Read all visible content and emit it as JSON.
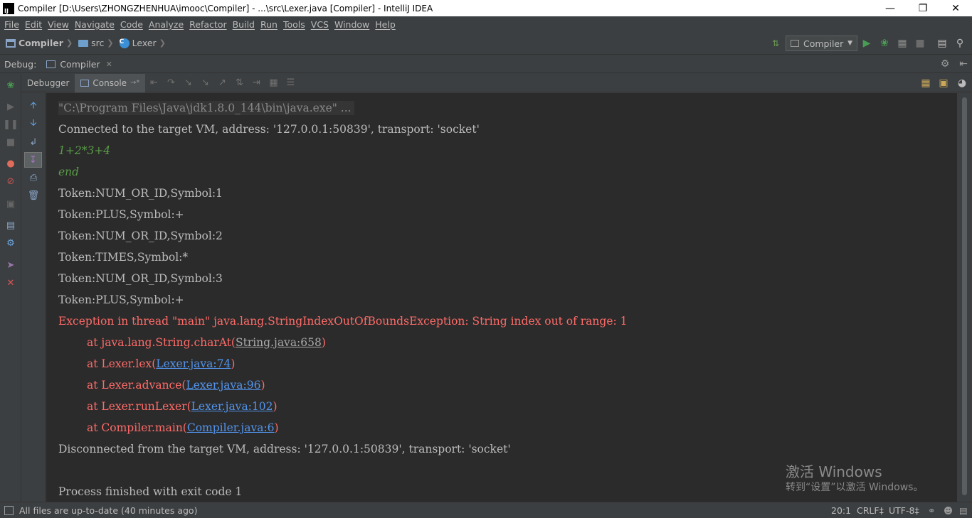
{
  "window": {
    "title": "Compiler [D:\\Users\\ZHONGZHENHUA\\imooc\\Compiler] - ...\\src\\Lexer.java [Compiler] - IntelliJ IDEA",
    "app_icon_text": "IJ"
  },
  "menu": [
    "File",
    "Edit",
    "View",
    "Navigate",
    "Code",
    "Analyze",
    "Refactor",
    "Build",
    "Run",
    "Tools",
    "VCS",
    "Window",
    "Help"
  ],
  "breadcrumb": {
    "project": "Compiler",
    "folder": "src",
    "file": "Lexer"
  },
  "run_config": {
    "name": "Compiler"
  },
  "debug": {
    "label": "Debug:",
    "session_tab": "Compiler"
  },
  "tabs": {
    "debugger": "Debugger",
    "console": "Console"
  },
  "console": {
    "command": "\"C:\\Program Files\\Java\\jdk1.8.0_144\\bin\\java.exe\" ...",
    "connected": "Connected to the target VM, address: '127.0.0.1:50839', transport: 'socket'",
    "input1": "1+2*3+4",
    "input2": "end",
    "tokens": [
      "Token:NUM_OR_ID,Symbol:1",
      "Token:PLUS,Symbol:+",
      "Token:NUM_OR_ID,Symbol:2",
      "Token:TIMES,Symbol:*",
      "Token:NUM_OR_ID,Symbol:3",
      "Token:PLUS,Symbol:+"
    ],
    "exception": "Exception in thread \"main\" java.lang.StringIndexOutOfBoundsException: String index out of range: 1",
    "stack": [
      {
        "prefix": "at java.lang.String.charAt(",
        "link": "String.java:658",
        "suffix": ")"
      },
      {
        "prefix": "at Lexer.lex(",
        "link": "Lexer.java:74",
        "suffix": ")"
      },
      {
        "prefix": "at Lexer.advance(",
        "link": "Lexer.java:96",
        "suffix": ")"
      },
      {
        "prefix": "at Lexer.runLexer(",
        "link": "Lexer.java:102",
        "suffix": ")"
      },
      {
        "prefix": "at Compiler.main(",
        "link": "Compiler.java:6",
        "suffix": ")"
      }
    ],
    "disconnected": "Disconnected from the target VM, address: '127.0.0.1:50839', transport: 'socket'",
    "finished": "Process finished with exit code 1"
  },
  "watermark": {
    "line1": "激活 Windows",
    "line2": "转到“设置”以激活 Windows。"
  },
  "status": {
    "message": "All files are up-to-date (40 minutes ago)",
    "position": "20:1",
    "line_sep": "CRLF‡",
    "encoding": "UTF-8‡"
  },
  "colors": {
    "console_bg": "#2b2b2b",
    "error": "#ff6b68",
    "link": "#5394ec",
    "user_input": "#5a9c47",
    "run_green": "#499c54"
  }
}
